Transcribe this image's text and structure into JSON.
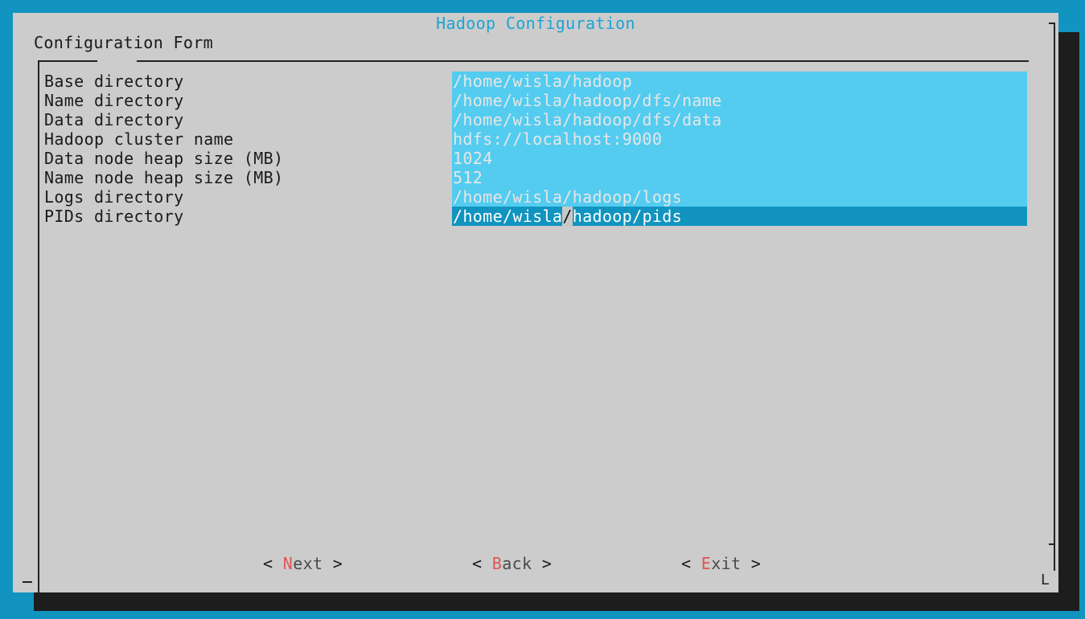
{
  "dialog": {
    "title": "Hadoop Configuration",
    "form_title": "Configuration Form",
    "corner_glyph": "L"
  },
  "form": {
    "rows": [
      {
        "label": "Base directory",
        "value": "/home/wisla/hadoop"
      },
      {
        "label": "Name directory",
        "value": "/home/wisla/hadoop/dfs/name"
      },
      {
        "label": "Data directory",
        "value": "/home/wisla/hadoop/dfs/data"
      },
      {
        "label": "Hadoop cluster name",
        "value": "hdfs://localhost:9000"
      },
      {
        "label": "Data node heap size (MB)",
        "value": "1024"
      },
      {
        "label": "Name node heap size (MB)",
        "value": "512"
      },
      {
        "label": "Logs directory",
        "value": "/home/wisla/hadoop/logs"
      },
      {
        "label": "PIDs directory",
        "value_before_cursor": "/home/wisla",
        "cursor_char": "/",
        "value_after_cursor": "hadoop/pids"
      }
    ],
    "active_row": "PIDs directory"
  },
  "buttons": {
    "next": {
      "open": "< ",
      "hotkey": "N",
      "rest": "ext",
      "close": " >"
    },
    "back": {
      "open": "< ",
      "hotkey": "B",
      "rest": "ack",
      "close": " >"
    },
    "exit": {
      "open": "< ",
      "hotkey": "E",
      "rest": "xit",
      "close": " >"
    }
  },
  "colors": {
    "background": "#1194bf",
    "dialog": "#cccccc",
    "title": "#1aa5d6",
    "field": "#53ccf0",
    "active_field": "#1194bf",
    "hotkey": "#e05555"
  }
}
